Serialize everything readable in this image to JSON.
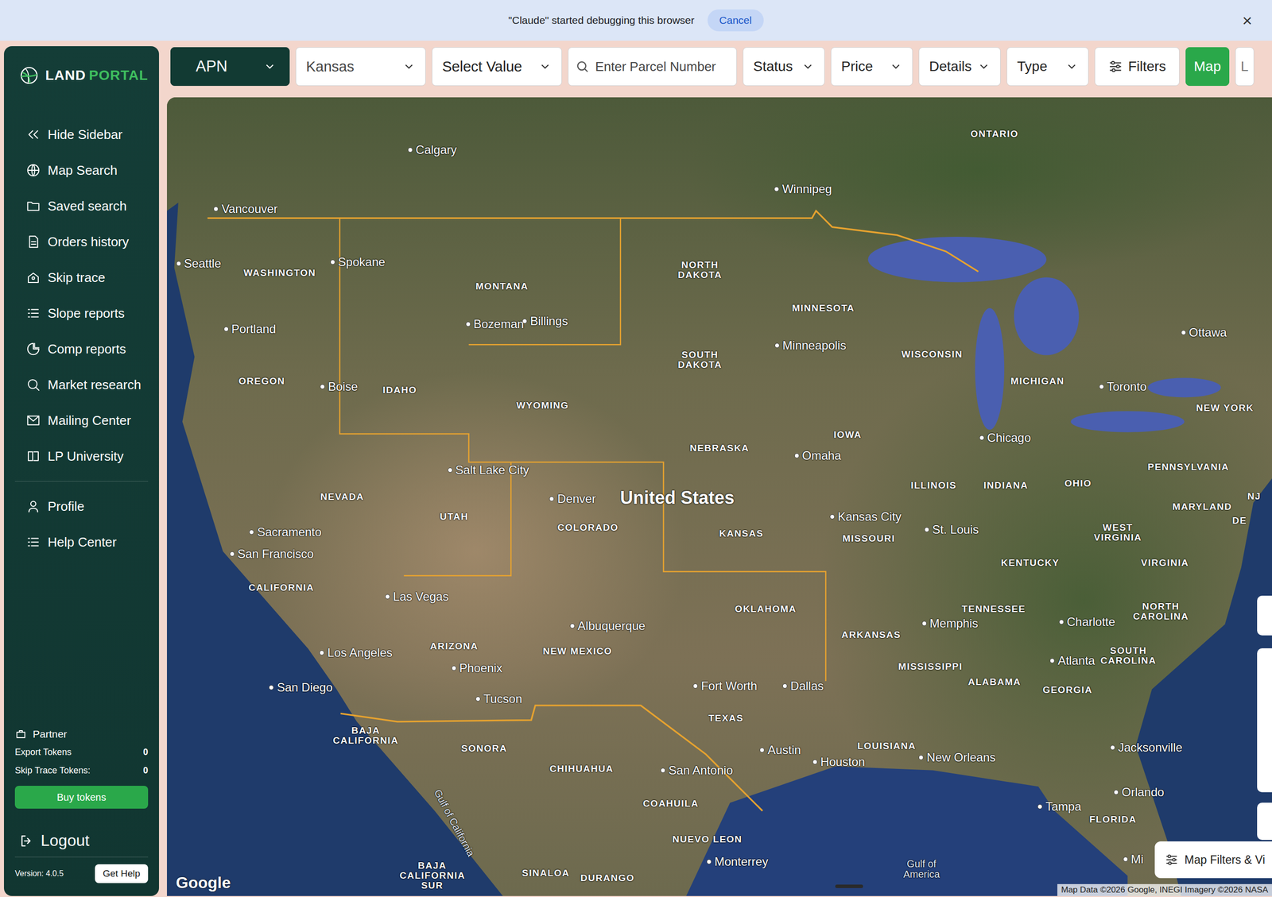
{
  "banner": {
    "message": "\"Claude\" started debugging this browser",
    "cancel": "Cancel",
    "close": "×"
  },
  "sidebar": {
    "logo": {
      "first": "LAND",
      "second": "PORTAL"
    },
    "items": [
      {
        "label": "Hide Sidebar"
      },
      {
        "label": "Map Search"
      },
      {
        "label": "Saved search"
      },
      {
        "label": "Orders history"
      },
      {
        "label": "Skip trace"
      },
      {
        "label": "Slope reports"
      },
      {
        "label": "Comp reports"
      },
      {
        "label": "Market research"
      },
      {
        "label": "Mailing Center"
      },
      {
        "label": "LP University"
      }
    ],
    "account_items": [
      {
        "label": "Profile"
      },
      {
        "label": "Help Center"
      }
    ],
    "partner": "Partner",
    "tokens": [
      {
        "label": "Export Tokens",
        "value": "0"
      },
      {
        "label": "Skip Trace Tokens:",
        "value": "0"
      }
    ],
    "buy": "Buy tokens",
    "logout": "Logout",
    "version": "Version: 4.0.5",
    "help": "Get Help"
  },
  "toolbar": {
    "search_type": "APN",
    "state": "Kansas",
    "value": "Select Value",
    "search_placeholder": "Enter Parcel Number",
    "filters": [
      "Status",
      "Price",
      "Details",
      "Type"
    ],
    "filters_button": "Filters",
    "views": [
      {
        "label": "Map",
        "selected": true
      },
      {
        "label": "L",
        "selected": false
      }
    ]
  },
  "map": {
    "labels": [
      {
        "text": "Calgary",
        "kind": "city"
      },
      {
        "text": "Winnipeg",
        "kind": "city"
      },
      {
        "text": "ONTARIO",
        "kind": "region"
      },
      {
        "text": "Vancouver",
        "kind": "city"
      },
      {
        "text": "Seattle",
        "kind": "city"
      },
      {
        "text": "WASHINGTON",
        "kind": "region"
      },
      {
        "text": "Spokane",
        "kind": "city"
      },
      {
        "text": "MONTANA",
        "kind": "region"
      },
      {
        "text": "NORTH DAKOTA",
        "kind": "region"
      },
      {
        "text": "MINNESOTA",
        "kind": "region"
      },
      {
        "text": "Bozeman",
        "kind": "city"
      },
      {
        "text": "Billings",
        "kind": "city"
      },
      {
        "text": "Portland",
        "kind": "city"
      },
      {
        "text": "Minneapolis",
        "kind": "city"
      },
      {
        "text": "WISCONSIN",
        "kind": "region"
      },
      {
        "text": "MICHIGAN",
        "kind": "region"
      },
      {
        "text": "Ottawa",
        "kind": "city"
      },
      {
        "text": "SOUTH DAKOTA",
        "kind": "region"
      },
      {
        "text": "Toronto",
        "kind": "city"
      },
      {
        "text": "OREGON",
        "kind": "region"
      },
      {
        "text": "Boise",
        "kind": "city"
      },
      {
        "text": "IDAHO",
        "kind": "region"
      },
      {
        "text": "WYOMING",
        "kind": "region"
      },
      {
        "text": "NEW YORK",
        "kind": "region"
      },
      {
        "text": "IOWA",
        "kind": "region"
      },
      {
        "text": "Chicago",
        "kind": "city"
      },
      {
        "text": "NEBRASKA",
        "kind": "region"
      },
      {
        "text": "Omaha",
        "kind": "city"
      },
      {
        "text": "PENNSYLVANIA",
        "kind": "region"
      },
      {
        "text": "Salt Lake City",
        "kind": "city"
      },
      {
        "text": "OHIO",
        "kind": "region"
      },
      {
        "text": "ILLINOIS",
        "kind": "region"
      },
      {
        "text": "INDIANA",
        "kind": "region"
      },
      {
        "text": "NEVADA",
        "kind": "region"
      },
      {
        "text": "Denver",
        "kind": "city"
      },
      {
        "text": "United States",
        "kind": "country"
      },
      {
        "text": "NJ",
        "kind": "region"
      },
      {
        "text": "UTAH",
        "kind": "region"
      },
      {
        "text": "Kansas City",
        "kind": "city"
      },
      {
        "text": "COLORADO",
        "kind": "region"
      },
      {
        "text": "KANSAS",
        "kind": "region"
      },
      {
        "text": "Sacramento",
        "kind": "city"
      },
      {
        "text": "St. Louis",
        "kind": "city"
      },
      {
        "text": "MISSOURI",
        "kind": "region"
      },
      {
        "text": "MARYLAND",
        "kind": "region"
      },
      {
        "text": "DE",
        "kind": "region"
      },
      {
        "text": "WEST VIRGINIA",
        "kind": "region"
      },
      {
        "text": "San Francisco",
        "kind": "city"
      },
      {
        "text": "VIRGINIA",
        "kind": "region"
      },
      {
        "text": "KENTUCKY",
        "kind": "region"
      },
      {
        "text": "CALIFORNIA",
        "kind": "region"
      },
      {
        "text": "Las Vegas",
        "kind": "city"
      },
      {
        "text": "OKLAHOMA",
        "kind": "region"
      },
      {
        "text": "TENNESSEE",
        "kind": "region"
      },
      {
        "text": "NORTH CAROLINA",
        "kind": "region"
      },
      {
        "text": "Memphis",
        "kind": "city"
      },
      {
        "text": "Charlotte",
        "kind": "city"
      },
      {
        "text": "Albuquerque",
        "kind": "city"
      },
      {
        "text": "ARKANSAS",
        "kind": "region"
      },
      {
        "text": "ARIZONA",
        "kind": "region"
      },
      {
        "text": "NEW MEXICO",
        "kind": "region"
      },
      {
        "text": "SOUTH CAROLINA",
        "kind": "region"
      },
      {
        "text": "Los Angeles",
        "kind": "city"
      },
      {
        "text": "Atlanta",
        "kind": "city"
      },
      {
        "text": "MISSISSIPPI",
        "kind": "region"
      },
      {
        "text": "ALABAMA",
        "kind": "region"
      },
      {
        "text": "Phoenix",
        "kind": "city"
      },
      {
        "text": "San Diego",
        "kind": "city"
      },
      {
        "text": "Fort Worth",
        "kind": "city"
      },
      {
        "text": "Dallas",
        "kind": "city"
      },
      {
        "text": "GEORGIA",
        "kind": "region"
      },
      {
        "text": "Tucson",
        "kind": "city"
      },
      {
        "text": "TEXAS",
        "kind": "region"
      },
      {
        "text": "BAJA CALIFORNIA",
        "kind": "region"
      },
      {
        "text": "Jacksonville",
        "kind": "city"
      },
      {
        "text": "LOUISIANA",
        "kind": "region"
      },
      {
        "text": "SONORA",
        "kind": "region"
      },
      {
        "text": "Austin",
        "kind": "city"
      },
      {
        "text": "Houston",
        "kind": "city"
      },
      {
        "text": "New Orleans",
        "kind": "city"
      },
      {
        "text": "CHIHUAHUA",
        "kind": "region"
      },
      {
        "text": "San Antonio",
        "kind": "city"
      },
      {
        "text": "Orlando",
        "kind": "city"
      },
      {
        "text": "Tampa",
        "kind": "city"
      },
      {
        "text": "COAHUILA",
        "kind": "region"
      },
      {
        "text": "FLORIDA",
        "kind": "region"
      },
      {
        "text": "Gulf of California",
        "kind": "water"
      },
      {
        "text": "NUEVO LEON",
        "kind": "region"
      },
      {
        "text": "Monterrey",
        "kind": "city"
      },
      {
        "text": "Gulf of America",
        "kind": "water"
      },
      {
        "text": "BAJA CALIFORNIA SUR",
        "kind": "region"
      },
      {
        "text": "SINALOA",
        "kind": "region"
      },
      {
        "text": "DURANGO",
        "kind": "region"
      },
      {
        "text": "Mi",
        "kind": "city"
      }
    ],
    "logo": "Google",
    "attribution": "Map Data ©2026 Google, INEGI Imagery ©2026 NASA",
    "filters_button": "Map Filters & Vi"
  }
}
